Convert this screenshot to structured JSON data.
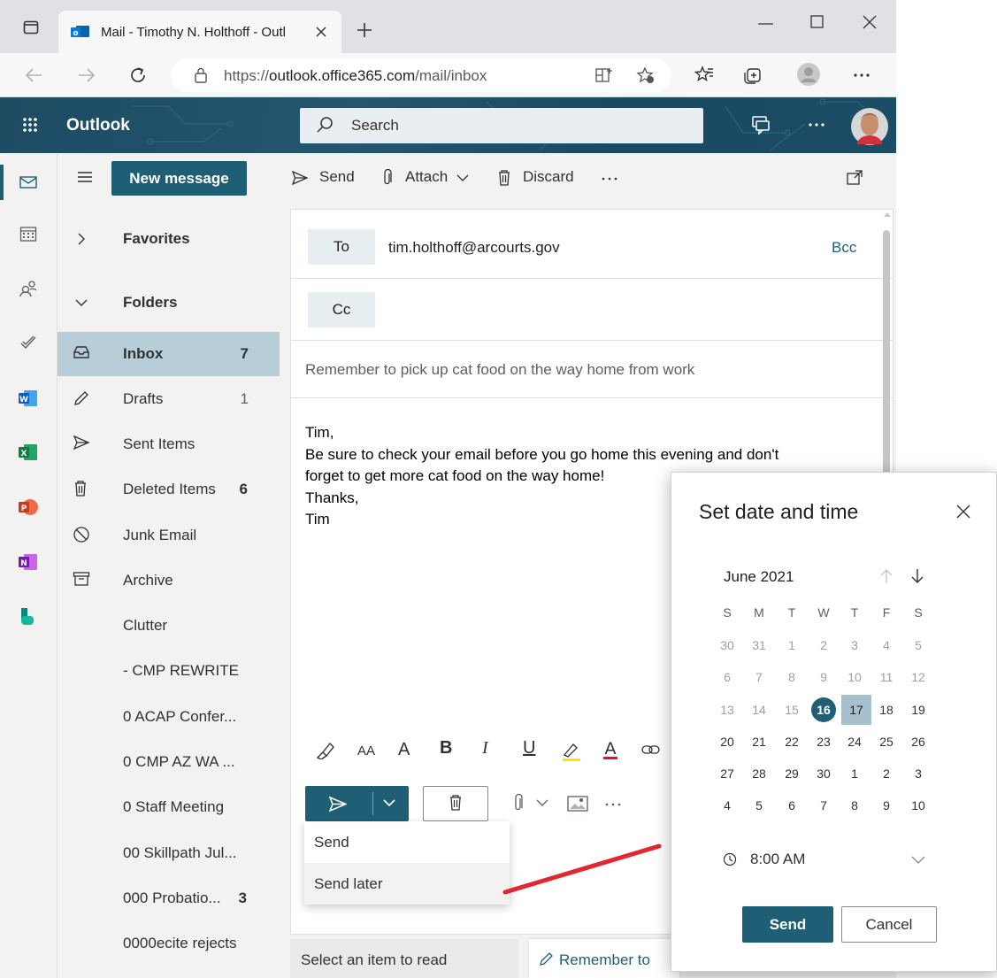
{
  "browser": {
    "tab_title": "Mail - Timothy N. Holthoff - Outl",
    "url_prefix": "https://",
    "url_host": "outlook.office365.com",
    "url_path": "/mail/inbox"
  },
  "header": {
    "app_name": "Outlook",
    "search_placeholder": "Search"
  },
  "folder_pane": {
    "new_message_label": "New message",
    "favorites_label": "Favorites",
    "folders_label": "Folders",
    "items": [
      {
        "label": "Inbox",
        "count": "7"
      },
      {
        "label": "Drafts",
        "count": "1"
      },
      {
        "label": "Sent Items",
        "count": ""
      },
      {
        "label": "Deleted Items",
        "count": "6"
      },
      {
        "label": "Junk Email",
        "count": ""
      },
      {
        "label": "Archive",
        "count": ""
      },
      {
        "label": "Clutter",
        "count": ""
      },
      {
        "label": "- CMP REWRITE",
        "count": ""
      },
      {
        "label": "0 ACAP Confer...",
        "count": ""
      },
      {
        "label": "0 CMP AZ WA ...",
        "count": ""
      },
      {
        "label": "0 Staff Meeting",
        "count": ""
      },
      {
        "label": "00 Skillpath Jul...",
        "count": ""
      },
      {
        "label": "000 Probatio...",
        "count": "3"
      },
      {
        "label": "0000ecite rejects",
        "count": ""
      }
    ]
  },
  "compose_toolbar": {
    "send_label": "Send",
    "attach_label": "Attach",
    "discard_label": "Discard"
  },
  "compose": {
    "to_label": "To",
    "to_value": "tim.holthoff@arcourts.gov",
    "bcc_label": "Bcc",
    "cc_label": "Cc",
    "subject": "Remember to pick up cat food on the way home from work",
    "body_lines": [
      "Tim,",
      "Be sure to check your email before you go home this evening and don't",
      "forget to get more cat food on the way home!",
      "Thanks,",
      "Tim"
    ]
  },
  "send_menu": {
    "items": [
      "Send",
      "Send later"
    ]
  },
  "bottom_tabs": {
    "tab1": "Select an item to read",
    "tab2": "Remember to"
  },
  "date_dialog": {
    "title": "Set date and time",
    "month": "June 2021",
    "weekdays": [
      "S",
      "M",
      "T",
      "W",
      "T",
      "F",
      "S"
    ],
    "weeks": [
      [
        "30",
        "31",
        "1",
        "2",
        "3",
        "4",
        "5"
      ],
      [
        "6",
        "7",
        "8",
        "9",
        "10",
        "11",
        "12"
      ],
      [
        "13",
        "14",
        "15",
        "16",
        "17",
        "18",
        "19"
      ],
      [
        "20",
        "21",
        "22",
        "23",
        "24",
        "25",
        "26"
      ],
      [
        "27",
        "28",
        "29",
        "30",
        "1",
        "2",
        "3"
      ],
      [
        "4",
        "5",
        "6",
        "7",
        "8",
        "9",
        "10"
      ]
    ],
    "time": "8:00 AM",
    "send_label": "Send",
    "cancel_label": "Cancel"
  },
  "colors": {
    "accent": "#1f5f75",
    "header_bg": "#1e4f67",
    "selected_folder": "#b7cdd7",
    "annotation_red": "#e3262f"
  }
}
